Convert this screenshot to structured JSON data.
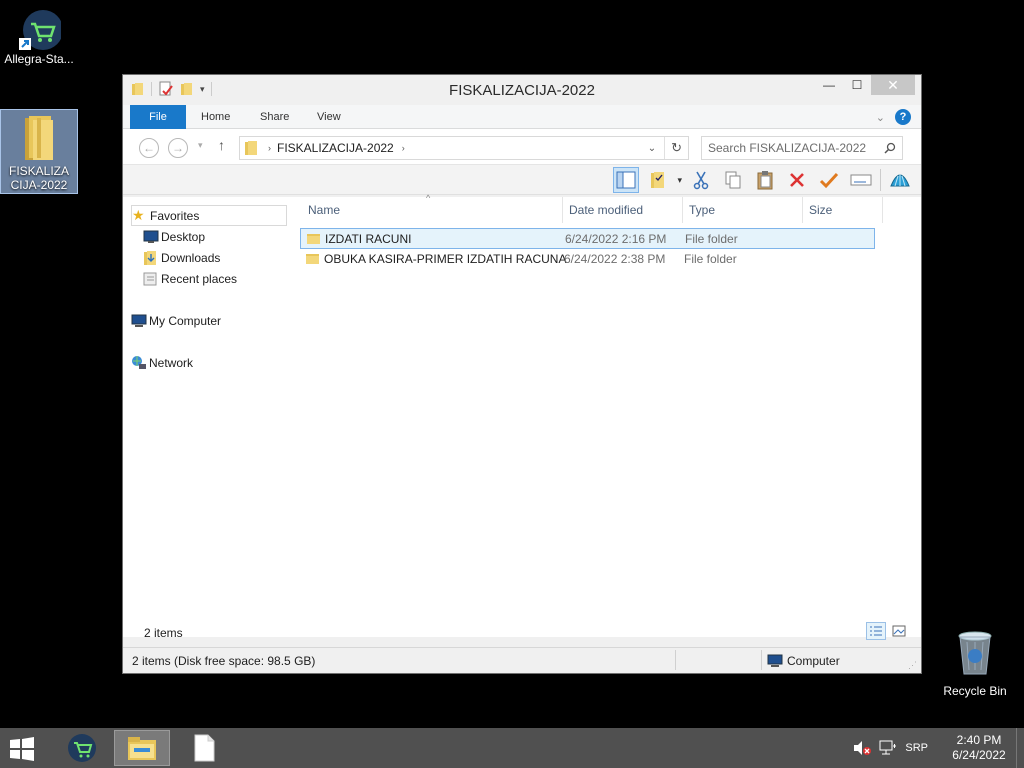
{
  "desktop": {
    "icons": [
      {
        "label": "Allegra-Sta..."
      },
      {
        "label": "FISKALIZACIJA-2022"
      },
      {
        "label": "Recycle Bin"
      }
    ]
  },
  "window": {
    "title": "FISKALIZACIJA-2022",
    "ribbon_tabs": {
      "file": "File",
      "home": "Home",
      "share": "Share",
      "view": "View"
    },
    "address_path": "FISKALIZACIJA-2022",
    "search_placeholder": "Search FISKALIZACIJA-2022",
    "nav": {
      "favorites": "Favorites",
      "desktop": "Desktop",
      "downloads": "Downloads",
      "recent": "Recent places",
      "computer": "My Computer",
      "network": "Network"
    },
    "columns": {
      "name": "Name",
      "date": "Date modified",
      "type": "Type",
      "size": "Size"
    },
    "rows": [
      {
        "name": "IZDATI RACUNI",
        "date": "6/24/2022 2:16 PM",
        "type": "File folder"
      },
      {
        "name": "OBUKA KASIRA-PRIMER IZDATIH RACUNA",
        "date": "6/24/2022 2:38 PM",
        "type": "File folder"
      }
    ],
    "item_count": "2 items",
    "status_left": "2 items (Disk free space: 98.5 GB)",
    "status_right": "Computer"
  },
  "taskbar": {
    "language": "SRP",
    "time": "2:40 PM",
    "date": "6/24/2022"
  },
  "colors": {
    "accent": "#1979ca",
    "selection": "#e5f3fb",
    "folder": "#e8c65a",
    "taskbar": "#505050"
  }
}
